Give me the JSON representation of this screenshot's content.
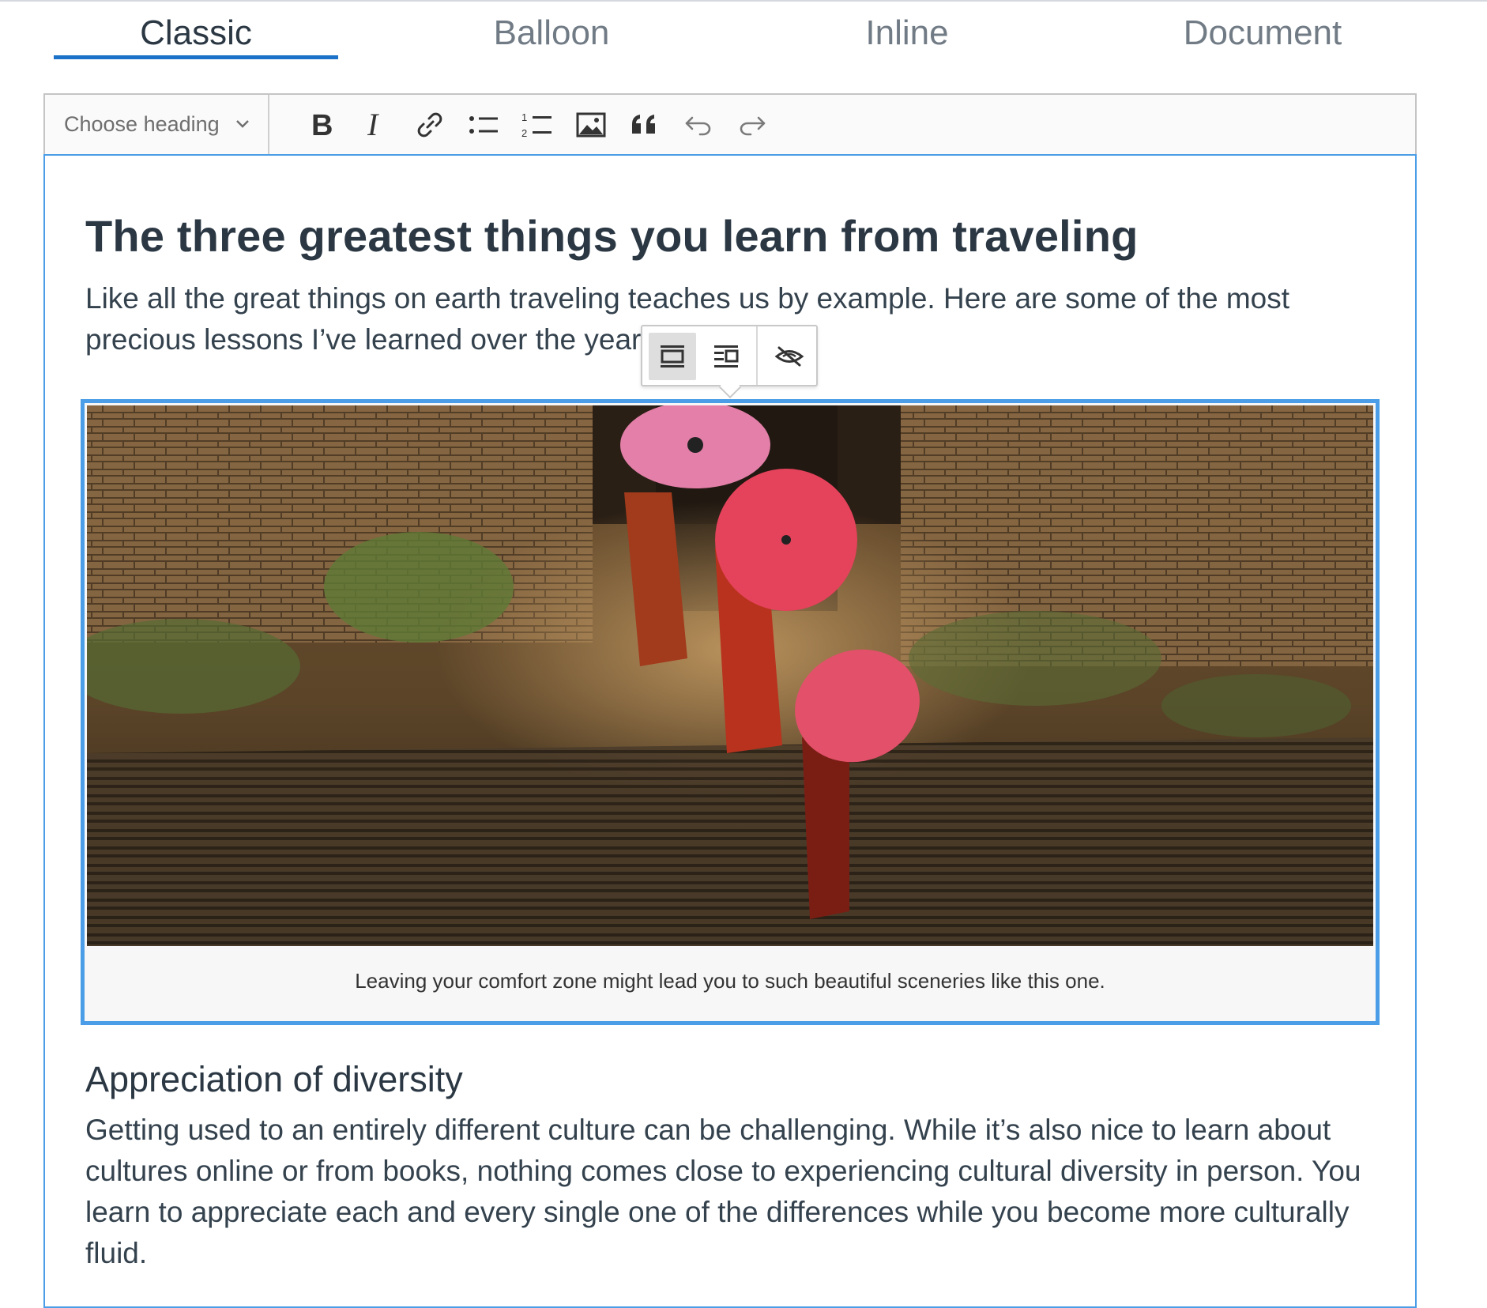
{
  "tabs": [
    {
      "label": "Classic",
      "active": true
    },
    {
      "label": "Balloon",
      "active": false
    },
    {
      "label": "Inline",
      "active": false
    },
    {
      "label": "Document",
      "active": false
    }
  ],
  "toolbar": {
    "heading_placeholder": "Choose heading",
    "buttons": [
      "bold-icon",
      "italic-icon",
      "link-icon",
      "bulleted-list-icon",
      "numbered-list-icon",
      "insert-image-icon",
      "block-quote-icon",
      "undo-icon",
      "redo-icon"
    ]
  },
  "document": {
    "title": "The three greatest things you learn from traveling",
    "intro": "Like all the great things on earth traveling teaches us by example. Here are some of the most precious lessons I’ve learned over the years of traveling.",
    "image_caption": "Leaving your comfort zone might lead you to such beautiful sceneries like this one.",
    "section_heading": "Appreciation of diversity",
    "section_body": "Getting used to an entirely different culture can be challenging. While it’s also nice to learn about cultures online or from books, nothing comes close to experiencing cultural diversity in person. You learn to appreciate each and every single one of the differences while you become more culturally fluid."
  },
  "image_balloon": {
    "buttons": [
      "full-size-image-icon",
      "side-image-icon",
      "toggle-caption-icon"
    ],
    "active": "full-size-image-icon"
  },
  "colors": {
    "accent": "#1b72c8",
    "focus_border": "#4a9de6",
    "text": "#2b3844",
    "tab_inactive": "#717b85"
  }
}
